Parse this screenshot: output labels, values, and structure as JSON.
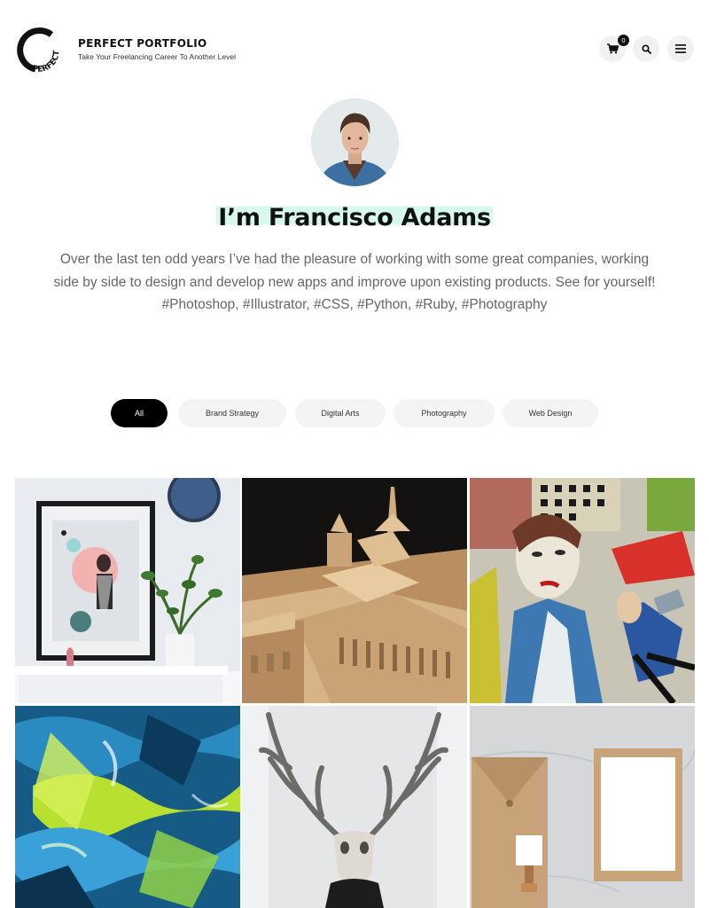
{
  "header": {
    "logo_text": "PERFECT",
    "brand_title": "PERFECT PORTFOLIO",
    "tagline": "Take Your Freelancing Career To Another Level",
    "cart_count": "0",
    "icons": [
      "cart-icon",
      "search-icon",
      "menu-icon"
    ]
  },
  "profile": {
    "headline": "I’m Francisco Adams",
    "bio": "Over the last ten odd years I’ve had the pleasure of working with some great companies, working side by side to design and develop new apps and improve upon existing products. See for yourself!",
    "tags": "#Photoshop, #Illustrator, #CSS, #Python, #Ruby, #Photography"
  },
  "filters": [
    {
      "label": "All",
      "active": true
    },
    {
      "label": "Brand Strategy",
      "active": false
    },
    {
      "label": "Digital Arts",
      "active": false
    },
    {
      "label": "Photography",
      "active": false
    },
    {
      "label": "Web Design",
      "active": false
    }
  ],
  "colors": {
    "accent_highlight": "#d8f8ee",
    "active_filter": "#000000",
    "filter_bg": "#f4f4f4",
    "body_text": "#666666"
  }
}
